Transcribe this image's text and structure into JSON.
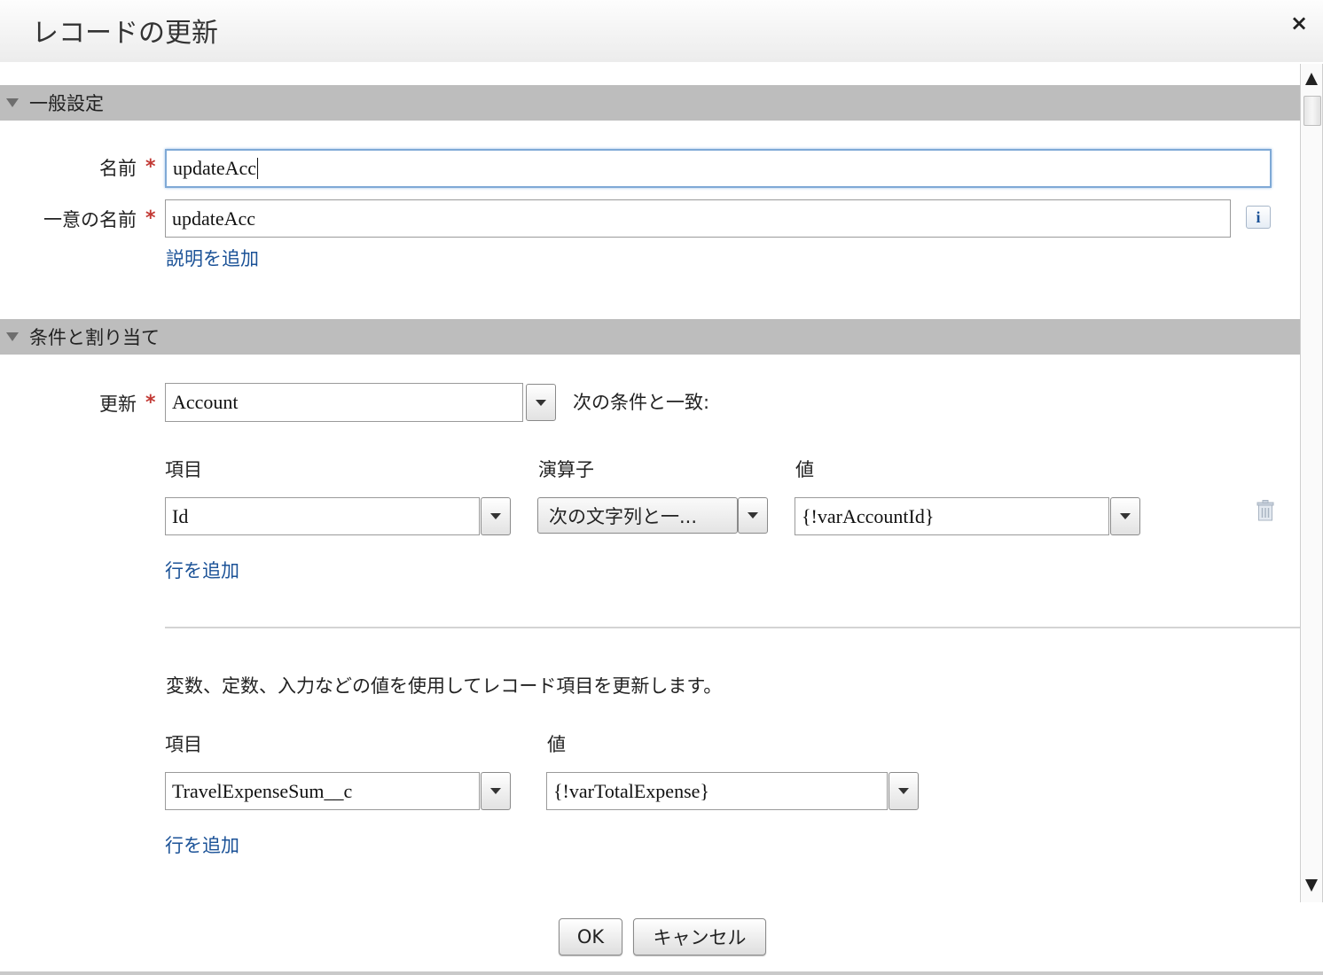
{
  "dialog": {
    "title": "レコードの更新",
    "close_symbol": "×"
  },
  "general": {
    "section_title": "一般設定",
    "name_label": "名前",
    "name_value": "updateAcc",
    "unique_name_label": "一意の名前",
    "unique_name_value": "updateAcc",
    "required_mark": "*",
    "info_symbol": "i",
    "add_description": "説明を追加"
  },
  "conditions": {
    "section_title": "条件と割り当て",
    "update_label": "更新",
    "object_value": "Account",
    "match_text": "次の条件と一致:",
    "headers": {
      "field": "項目",
      "operator": "演算子",
      "value": "値"
    },
    "row": {
      "field": "Id",
      "operator": "次の文字列と一...",
      "value": "{!varAccountId}"
    },
    "add_row": "行を追加"
  },
  "assignments": {
    "description": "変数、定数、入力などの値を使用してレコード項目を更新します。",
    "headers": {
      "field": "項目",
      "value": "値"
    },
    "row": {
      "field": "TravelExpenseSum__c",
      "value": "{!varTotalExpense}"
    },
    "add_row": "行を追加"
  },
  "footer": {
    "ok": "OK",
    "cancel": "キャンセル"
  },
  "icons": {
    "close": "close-icon",
    "collapse": "triangle-down-icon",
    "dropdown": "chevron-down-icon",
    "info": "info-icon",
    "delete": "trash-icon",
    "scroll_up": "scroll-up-icon",
    "scroll_down": "scroll-down-icon"
  },
  "colors": {
    "link": "#1b5297",
    "required": "#c23934",
    "section_bar": "#bdbdbd"
  }
}
